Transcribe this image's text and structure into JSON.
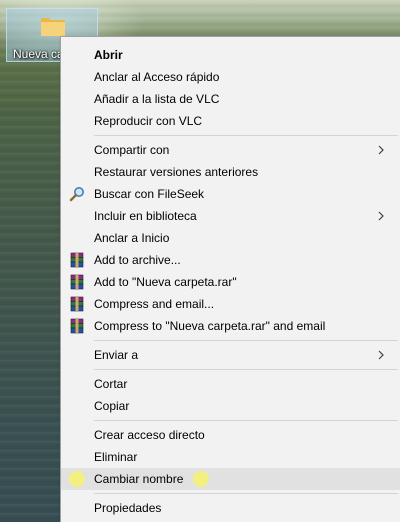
{
  "desktop": {
    "icon_label": "Nueva ca"
  },
  "menu": {
    "items": [
      {
        "label": "Abrir",
        "bold": true
      },
      {
        "label": "Anclar al Acceso rápido"
      },
      {
        "label": "Añadir a la lista de VLC"
      },
      {
        "label": "Reproducir con VLC"
      },
      {
        "label": "Compartir con",
        "submenu": true
      },
      {
        "label": "Restaurar versiones anteriores"
      },
      {
        "label": "Buscar con FileSeek",
        "icon": "magnifier-icon"
      },
      {
        "label": "Incluir en biblioteca",
        "submenu": true
      },
      {
        "label": "Anclar a Inicio"
      },
      {
        "label": "Add to archive...",
        "icon": "winrar-icon"
      },
      {
        "label": "Add to \"Nueva carpeta.rar\"",
        "icon": "winrar-icon"
      },
      {
        "label": "Compress and email...",
        "icon": "winrar-icon"
      },
      {
        "label": "Compress to \"Nueva carpeta.rar\" and email",
        "icon": "winrar-icon"
      },
      {
        "label": "Enviar a",
        "submenu": true
      },
      {
        "label": "Cortar"
      },
      {
        "label": "Copiar"
      },
      {
        "label": "Crear acceso directo"
      },
      {
        "label": "Eliminar"
      },
      {
        "label": "Cambiar nombre",
        "highlighted": true
      },
      {
        "label": "Propiedades"
      }
    ]
  },
  "colors": {
    "menu_background": "#f2f2f2",
    "highlight": "#e1e1e1",
    "marker": "#f3f07a"
  }
}
